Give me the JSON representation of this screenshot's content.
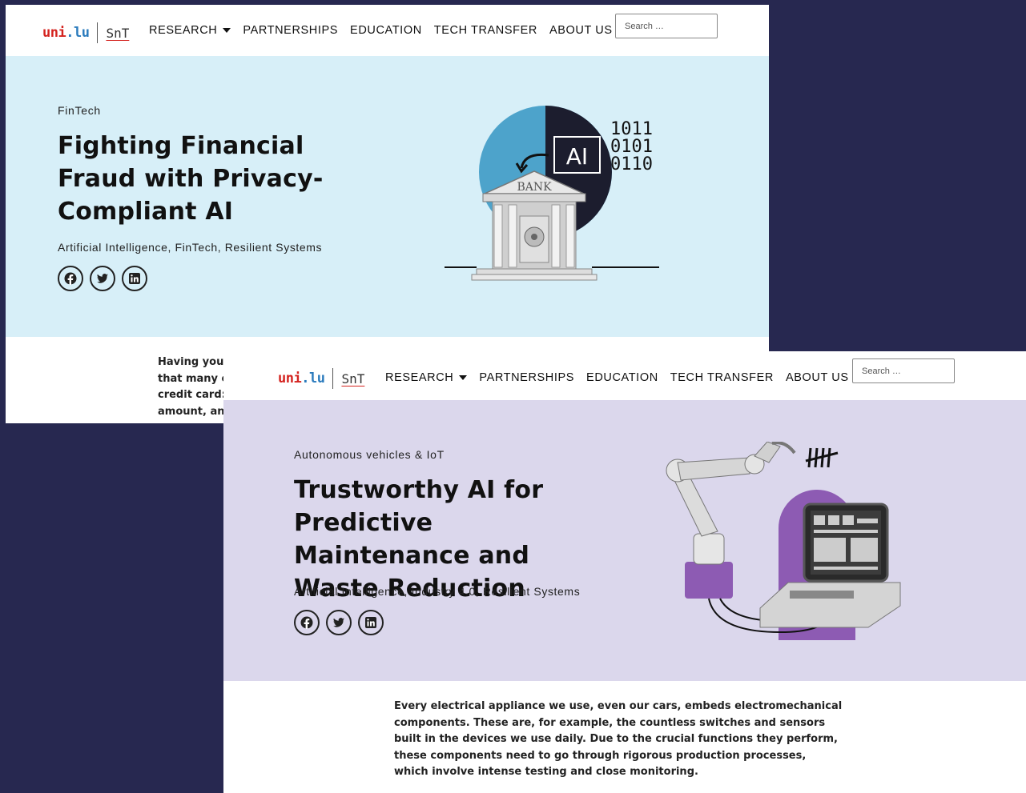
{
  "nav": {
    "logo_uni_prefix": "uni",
    "logo_uni_suffix": ".lu",
    "logo_snt": "SnT",
    "items": [
      {
        "label": "RESEARCH",
        "dropdown": true
      },
      {
        "label": "PARTNERSHIPS",
        "dropdown": false
      },
      {
        "label": "EDUCATION",
        "dropdown": false
      },
      {
        "label": "TECH TRANSFER",
        "dropdown": false
      },
      {
        "label": "ABOUT US",
        "dropdown": true
      }
    ],
    "search_placeholder": "Search …"
  },
  "windows": [
    {
      "category": "FinTech",
      "title": "Fighting Financial Fraud with Privacy-Compliant AI",
      "tags": "Artificial Intelligence, FinTech, Resilient Systems",
      "hero_bg": "#d7eff8",
      "illustration": {
        "label_bank": "BANK",
        "label_ai": "AI",
        "binary": [
          "1011",
          "0101",
          "0110"
        ]
      },
      "body": "Having your ... that many c... credit cards ... amount, and ...",
      "body_lines": [
        "Having your",
        "that many c",
        "credit card:",
        "amount, an"
      ]
    },
    {
      "category": "Autonomous vehicles & IoT",
      "title": "Trustworthy AI for Predictive Maintenance and Waste Reduction",
      "tags": "Artificial Intelligence, Industry 4.0, Resilient Systems",
      "hero_bg": "#dbd7ec",
      "body": "Every electrical appliance we use, even our cars, embeds electromechanical components. These are, for example, the countless switches and sensors built in the devices we use daily. Due to the crucial functions they perform, these components need to go through rigorous production processes, which involve intense testing and close monitoring."
    }
  ],
  "social_icons": [
    "facebook-icon",
    "twitter-icon",
    "linkedin-icon"
  ],
  "colors": {
    "background": "#272850",
    "logo_red": "#d4231f",
    "logo_blue": "#2b7bbd",
    "accent_purple": "#8d5bb3",
    "accent_blue": "#4da3cb"
  }
}
